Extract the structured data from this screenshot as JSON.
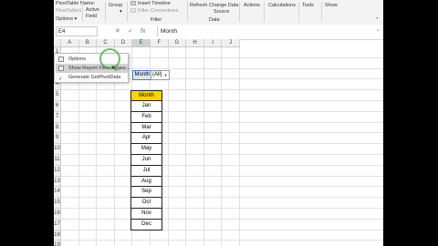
{
  "ribbon": {
    "pivottable_name_label": "PivotTable Name:",
    "pivottable_name_value": "PivotTable1",
    "options_button": "Options",
    "active_field": [
      "Active",
      "Field"
    ],
    "group": "Group",
    "insert_timeline": "Insert Timeline",
    "filter_connections": "Filter Connections",
    "filter_group_label": "Filter",
    "refresh": "Refresh",
    "change_data_source": [
      "Change Data",
      "Source"
    ],
    "data_group_label": "Data",
    "actions": "Actions",
    "calculations": "Calculations",
    "tools": "Tools",
    "show": "Show"
  },
  "menu": {
    "items": [
      "Options",
      "Show Report Filter Pages...",
      "Generate GetPivotData"
    ]
  },
  "formula_bar": {
    "name_box": "E4",
    "cancel": "✕",
    "enter": "✓",
    "fx": "fx",
    "content": "Month"
  },
  "grid": {
    "columns": [
      "A",
      "B",
      "C",
      "D",
      "E",
      "F",
      "G",
      "H",
      "I",
      "J"
    ],
    "rows": [
      "1",
      "2",
      "3",
      "4",
      "5",
      "6",
      "7",
      "8",
      "9",
      "10",
      "11",
      "12",
      "13",
      "14",
      "15",
      "16",
      "17",
      "18",
      "19"
    ],
    "selected_column": "E",
    "month_header": "Month",
    "months": [
      "Jan",
      "Feb",
      "Mar",
      "Apr",
      "May",
      "Jun",
      "Jul",
      "Aug",
      "Sep",
      "Oct",
      "Nov",
      "Dec"
    ],
    "filter_label": "Month",
    "filter_value": "(All)"
  }
}
